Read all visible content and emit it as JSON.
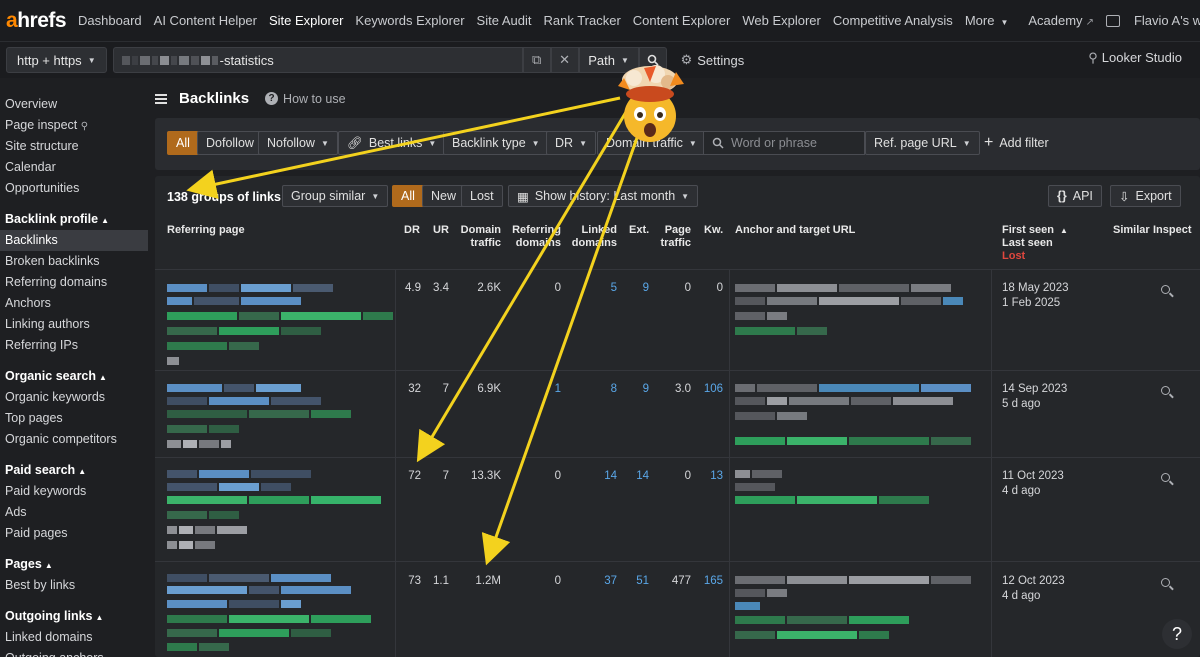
{
  "topnav": {
    "logo_a": "a",
    "logo_rest": "hrefs",
    "items": [
      "Dashboard",
      "AI Content Helper",
      "Site Explorer",
      "Keywords Explorer",
      "Site Audit",
      "Rank Tracker",
      "Content Explorer",
      "Web Explorer",
      "Competitive Analysis",
      "More"
    ],
    "academy": "Academy",
    "account": "Flavio A's worksp..."
  },
  "urlbar": {
    "protocol": "http + https",
    "url_suffix": "-statistics",
    "mode": "Path",
    "settings": "Settings",
    "looker": "Looker Studio"
  },
  "sidebar": {
    "top_items": [
      "Overview",
      "Page inspect",
      "Site structure",
      "Calendar",
      "Opportunities"
    ],
    "sections": [
      {
        "title": "Backlink profile",
        "items": [
          "Backlinks",
          "Broken backlinks",
          "Referring domains",
          "Anchors",
          "Linking authors",
          "Referring IPs"
        ]
      },
      {
        "title": "Organic search",
        "items": [
          "Organic keywords",
          "Top pages",
          "Organic competitors"
        ]
      },
      {
        "title": "Paid search",
        "items": [
          "Paid keywords",
          "Ads",
          "Paid pages"
        ]
      },
      {
        "title": "Pages",
        "items": [
          "Best by links"
        ]
      },
      {
        "title": "Outgoing links",
        "items": [
          "Linked domains",
          "Outgoing anchors"
        ]
      }
    ]
  },
  "page": {
    "title": "Backlinks",
    "how_to": "How to use"
  },
  "filters": {
    "all": "All",
    "dofollow": "Dofollow",
    "nofollow": "Nofollow",
    "best_links": "Best links",
    "backlink_type": "Backlink type",
    "dr": "DR",
    "domain_traffic": "Domain traffic",
    "search_placeholder": "Word or phrase",
    "ref_page_url": "Ref. page URL",
    "add_filter": "Add filter"
  },
  "table": {
    "groups_label": "138 groups of links",
    "group_similar": "Group similar",
    "tab_all": "All",
    "tab_new": "New",
    "tab_lost": "Lost",
    "history": "Show history: Last month",
    "api": "API",
    "export": "Export",
    "headers": {
      "referring_page": "Referring page",
      "dr": "DR",
      "ur": "UR",
      "domain_traffic_1": "Domain",
      "domain_traffic_2": "traffic",
      "referring_domains_1": "Referring",
      "referring_domains_2": "domains",
      "linked_domains_1": "Linked",
      "linked_domains_2": "domains",
      "ext": "Ext.",
      "page_traffic_1": "Page",
      "page_traffic_2": "traffic",
      "kw": "Kw.",
      "anchor": "Anchor and target URL",
      "first_seen": "First seen",
      "last_seen": "Last seen",
      "lost": "Lost",
      "similar": "Similar",
      "inspect": "Inspect"
    },
    "rows": [
      {
        "dr": "4.9",
        "ur": "3.4",
        "domain_traffic": "2.6K",
        "ref_domains": "0",
        "linked_domains": "5",
        "ext": "9",
        "page_traffic": "0",
        "kw": "0",
        "first_seen": "18 May 2023",
        "last_seen": "1 Feb 2025"
      },
      {
        "dr": "32",
        "ur": "7",
        "domain_traffic": "6.9K",
        "ref_domains": "1",
        "linked_domains": "8",
        "ext": "9",
        "page_traffic": "3.0",
        "kw": "106",
        "first_seen": "14 Sep 2023",
        "last_seen": "5 d ago"
      },
      {
        "dr": "72",
        "ur": "7",
        "domain_traffic": "13.3K",
        "ref_domains": "0",
        "linked_domains": "14",
        "ext": "14",
        "page_traffic": "0",
        "kw": "13",
        "first_seen": "11 Oct 2023",
        "last_seen": "4 d ago"
      },
      {
        "dr": "73",
        "ur": "1.1",
        "domain_traffic": "1.2M",
        "ref_domains": "0",
        "linked_domains": "37",
        "ext": "51",
        "page_traffic": "477",
        "kw": "165",
        "first_seen": "12 Oct 2023",
        "last_seen": "4 d ago"
      }
    ]
  },
  "help": "?",
  "colors": {
    "accent": "#b06a1c",
    "link": "#5aa7e8",
    "arrow": "#f3d21e",
    "lost": "#e0473e",
    "logo": "#ff8800"
  }
}
